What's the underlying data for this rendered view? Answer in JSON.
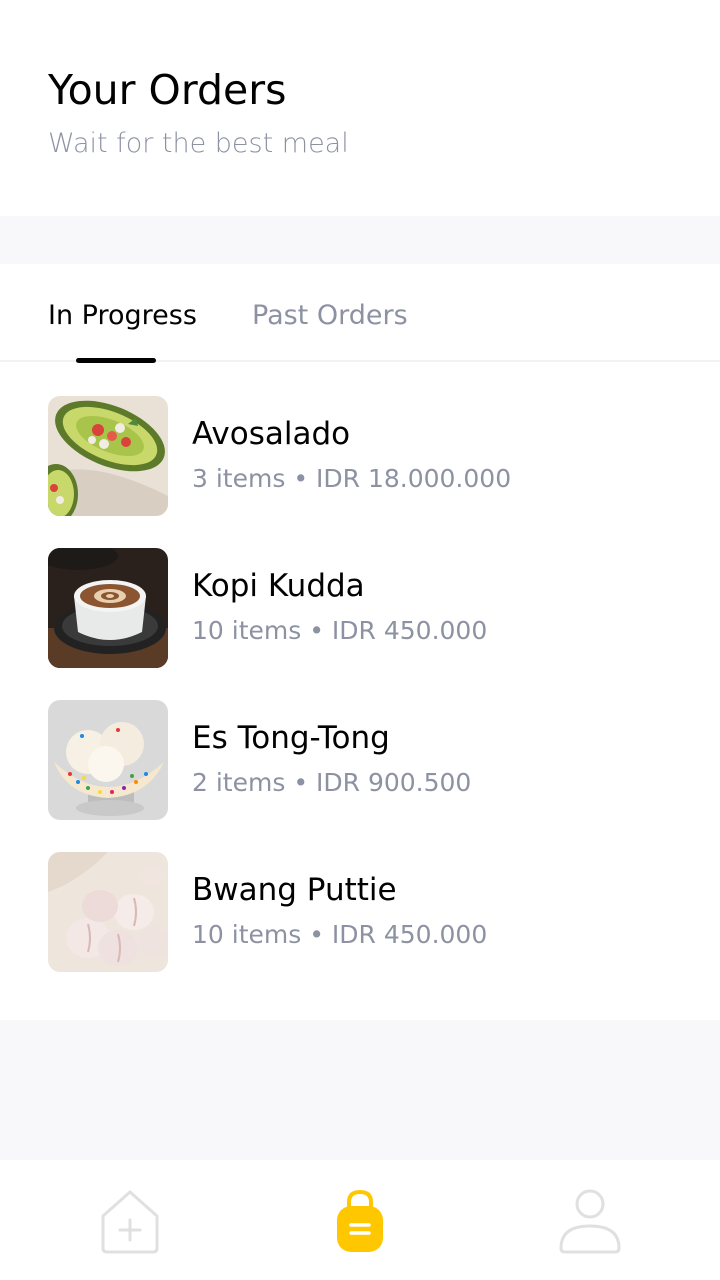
{
  "header": {
    "title": "Your Orders",
    "subtitle": "Wait for the best meal"
  },
  "tabs": [
    {
      "label": "In Progress",
      "active": true
    },
    {
      "label": "Past Orders",
      "active": false
    }
  ],
  "orders": [
    {
      "name": "Avosalado",
      "items": "3 items",
      "separator": "•",
      "price": "IDR 18.000.000",
      "image": "avocado-salad-photo"
    },
    {
      "name": "Kopi Kudda",
      "items": "10 items",
      "separator": "•",
      "price": "IDR 450.000",
      "image": "latte-coffee-photo"
    },
    {
      "name": "Es Tong-Tong",
      "items": "2 items",
      "separator": "•",
      "price": "IDR 900.500",
      "image": "ice-cream-photo"
    },
    {
      "name": "Bwang Puttie",
      "items": "10 items",
      "separator": "•",
      "price": "IDR 450.000",
      "image": "garlic-photo"
    }
  ],
  "bottom_nav": {
    "items": [
      {
        "icon": "home-add-icon",
        "active": false
      },
      {
        "icon": "shopping-bag-icon",
        "active": true
      },
      {
        "icon": "profile-icon",
        "active": false
      }
    ],
    "active_color": "#FFC700",
    "inactive_color": "#E0E0E0"
  },
  "colors": {
    "primary_text": "#020202",
    "secondary_text": "#8D92A3",
    "background": "#F8F8FA"
  }
}
